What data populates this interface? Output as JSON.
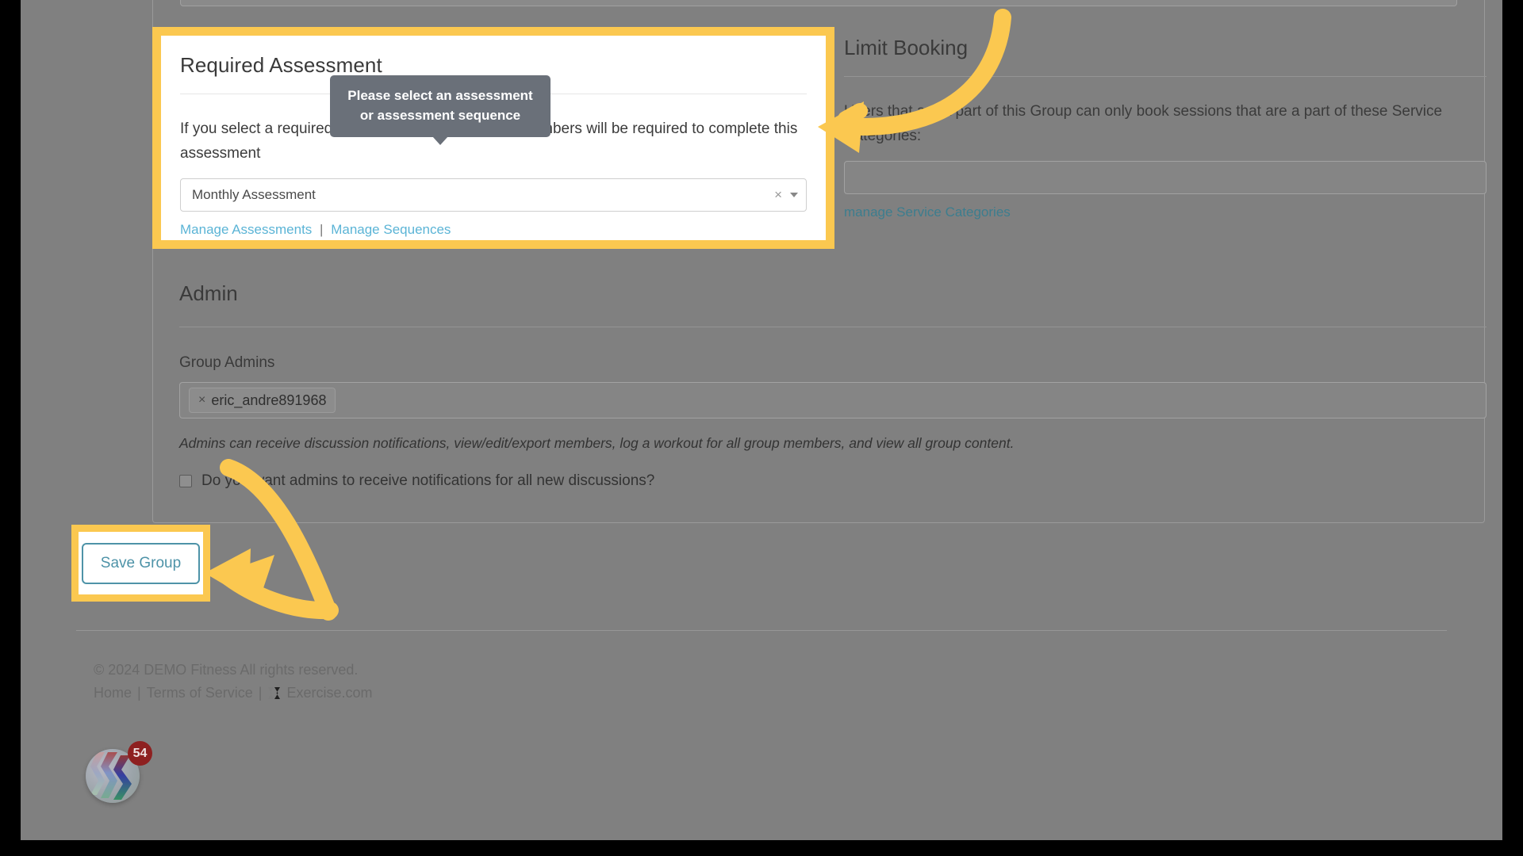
{
  "required_assessment": {
    "title": "Required Assessment",
    "description": "If you select a required assessment, then any new members will be required to complete this assessment",
    "select_value": "Monthly Assessment",
    "clear_icon": "×",
    "links": {
      "manage_assessments": "Manage Assessments",
      "separator": "|",
      "manage_sequences": "Manage Sequences"
    }
  },
  "tooltip": {
    "message": "Please select an assessment or assessment sequence"
  },
  "limit_booking": {
    "title": "Limit Booking",
    "description": "Users that are a part of this Group can only book sessions that are a part of these Service Categories:",
    "input_value": "",
    "link": "manage Service Categories"
  },
  "admin": {
    "title": "Admin",
    "group_admins_label": "Group Admins",
    "admin_tags": [
      {
        "remove_icon": "×",
        "name": "eric_andre891968"
      }
    ],
    "note": "Admins can receive discussion notifications, view/edit/export members, log a workout for all group members, and view all group content.",
    "checkbox_label": "Do you want admins to receive notifications for all new discussions?",
    "checkbox_checked": false
  },
  "actions": {
    "save_group": "Save Group"
  },
  "footer": {
    "copyright": "© 2024 DEMO Fitness All rights reserved.",
    "home": "Home",
    "pipe1": "|",
    "terms": "Terms of Service",
    "pipe2": "|",
    "exercise": "Exercise.com"
  },
  "app_badge": {
    "count": "54"
  },
  "colors": {
    "highlight": "#FBC850",
    "arrow": "#FBC850",
    "link": "#5bb4d6",
    "link_dim": "#3c7d8e",
    "button_border": "#4e93a8",
    "tooltip_bg": "#6a7079",
    "badge_bg": "#8e2020",
    "overlay": "#808080"
  }
}
